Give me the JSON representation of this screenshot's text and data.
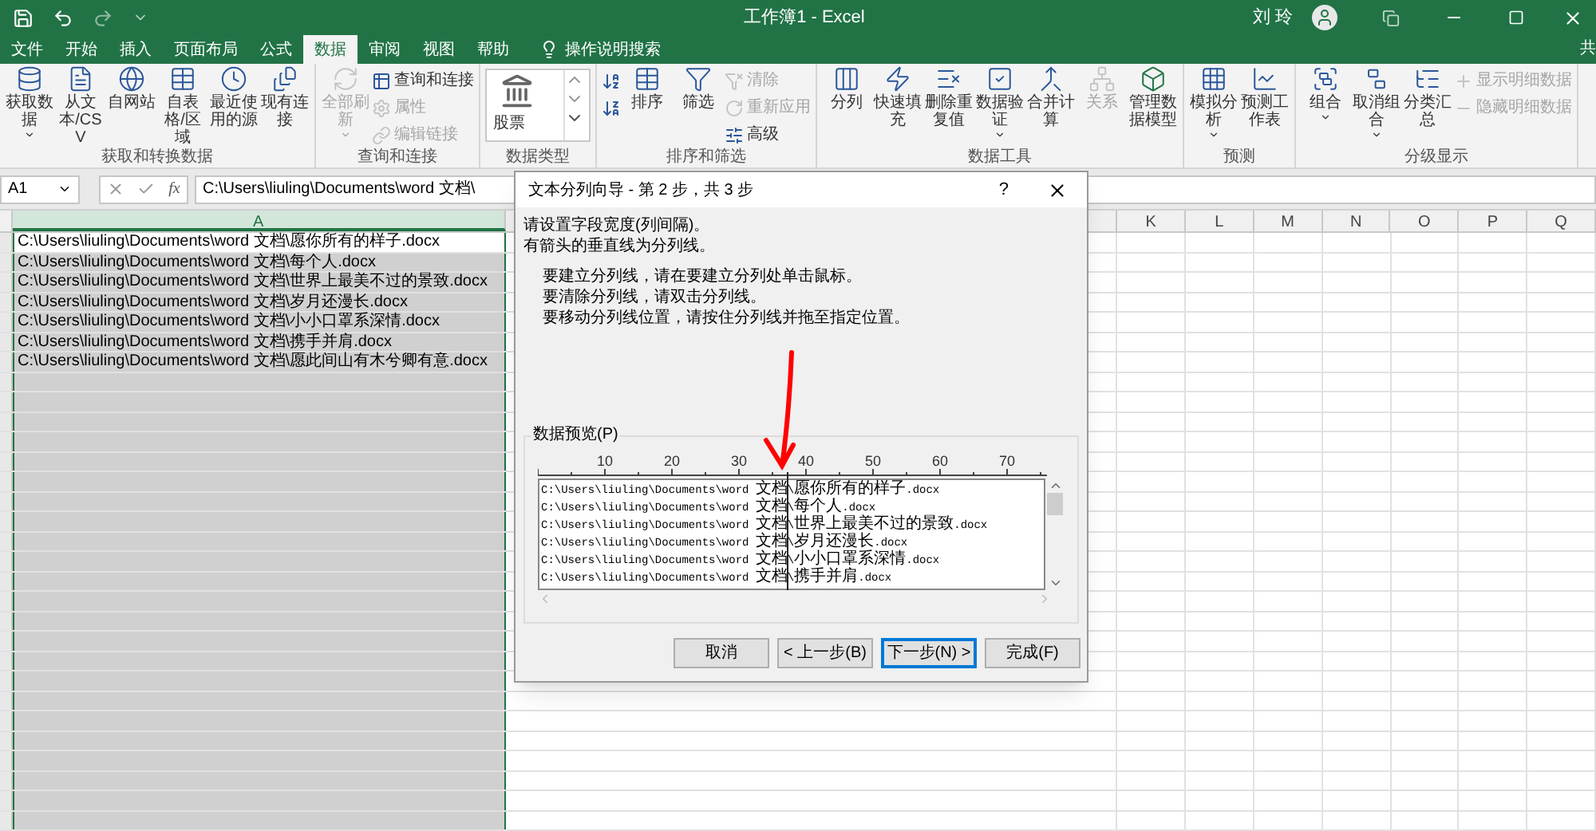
{
  "title_bar": {
    "title": "工作簿1 - Excel",
    "user": "刘 玲",
    "share": "共"
  },
  "tabs": [
    {
      "label": "文件",
      "selected": false
    },
    {
      "label": "开始",
      "selected": false
    },
    {
      "label": "插入",
      "selected": false
    },
    {
      "label": "页面布局",
      "selected": false
    },
    {
      "label": "公式",
      "selected": false
    },
    {
      "label": "数据",
      "selected": true
    },
    {
      "label": "审阅",
      "selected": false
    },
    {
      "label": "视图",
      "selected": false
    },
    {
      "label": "帮助",
      "selected": false
    }
  ],
  "search": {
    "placeholder": "操作说明搜索"
  },
  "ribbon": [
    {
      "label": "获取和转换数据",
      "items": [
        {
          "kind": "large",
          "label": "获取数据",
          "dropdown": true,
          "disabled": false
        },
        {
          "kind": "large",
          "label": "从文本/CSV",
          "disabled": false
        },
        {
          "kind": "large",
          "label": "自网站",
          "disabled": false
        },
        {
          "kind": "large",
          "label": "自表格/区域",
          "disabled": false
        },
        {
          "kind": "large",
          "label": "最近使用的源",
          "disabled": false
        },
        {
          "kind": "large",
          "label": "现有连接",
          "disabled": false
        }
      ]
    },
    {
      "label": "查询和连接",
      "items": [
        {
          "kind": "large",
          "label": "全部刷新",
          "dropdown": true,
          "disabled": true
        },
        {
          "kind": "small",
          "label": "查询和连接",
          "disabled": false
        },
        {
          "kind": "small",
          "label": "属性",
          "disabled": true
        },
        {
          "kind": "small",
          "label": "编辑链接",
          "disabled": true
        }
      ]
    },
    {
      "label": "数据类型",
      "items": [
        {
          "kind": "gallery",
          "label": "股票"
        }
      ]
    },
    {
      "label": "排序和筛选",
      "items": [
        {
          "kind": "small",
          "disabled": false
        },
        {
          "kind": "small",
          "disabled": false
        },
        {
          "kind": "large",
          "label": "排序",
          "disabled": false
        },
        {
          "kind": "large",
          "label": "筛选",
          "disabled": false
        },
        {
          "kind": "small",
          "label": "清除",
          "disabled": true
        },
        {
          "kind": "small",
          "label": "重新应用",
          "disabled": true
        },
        {
          "kind": "small",
          "label": "高级",
          "disabled": false
        }
      ]
    },
    {
      "label": "数据工具",
      "items": [
        {
          "kind": "large",
          "label": "分列",
          "disabled": false
        },
        {
          "kind": "large",
          "label": "快速填充",
          "disabled": false
        },
        {
          "kind": "large",
          "label": "删除重复值",
          "disabled": false
        },
        {
          "kind": "large",
          "label": "数据验证",
          "dropdown": true,
          "disabled": false
        },
        {
          "kind": "large",
          "label": "合并计算",
          "disabled": false
        },
        {
          "kind": "large",
          "label": "关系",
          "disabled": true
        },
        {
          "kind": "large",
          "label": "管理数据模型",
          "disabled": false
        }
      ]
    },
    {
      "label": "预测",
      "items": [
        {
          "kind": "large",
          "label": "模拟分析",
          "dropdown": true,
          "disabled": false
        },
        {
          "kind": "large",
          "label": "预测工作表",
          "disabled": false
        }
      ]
    },
    {
      "label": "分级显示",
      "items": [
        {
          "kind": "large",
          "label": "组合",
          "dropdown": true,
          "disabled": false
        },
        {
          "kind": "large",
          "label": "取消组合",
          "dropdown": true,
          "disabled": false
        },
        {
          "kind": "large",
          "label": "分类汇总",
          "disabled": false
        },
        {
          "kind": "small",
          "label": "显示明细数据",
          "disabled": true
        },
        {
          "kind": "small",
          "label": "隐藏明细数据",
          "disabled": true
        }
      ]
    }
  ],
  "formula_bar": {
    "name_box": "A1",
    "fx": "fx",
    "formula": "C:\\Users\\liuling\\Documents\\word 文档\\"
  },
  "columns": [
    {
      "label": "A",
      "selected": true
    },
    {
      "label": "K",
      "selected": false
    },
    {
      "label": "L",
      "selected": false
    },
    {
      "label": "M",
      "selected": false
    },
    {
      "label": "N",
      "selected": false
    },
    {
      "label": "O",
      "selected": false
    },
    {
      "label": "P",
      "selected": false
    },
    {
      "label": "Q",
      "selected": false
    }
  ],
  "cells": [
    {
      "text": "C:\\Users\\liuling\\Documents\\word 文档\\愿你所有的样子.docx",
      "active": true
    },
    {
      "text": "C:\\Users\\liuling\\Documents\\word 文档\\每个人.docx",
      "active": false
    },
    {
      "text": "C:\\Users\\liuling\\Documents\\word 文档\\世界上最美不过的景致.docx",
      "active": false
    },
    {
      "text": "C:\\Users\\liuling\\Documents\\word 文档\\岁月还漫长.docx",
      "active": false
    },
    {
      "text": "C:\\Users\\liuling\\Documents\\word 文档\\小小口罩系深情.docx",
      "active": false
    },
    {
      "text": "C:\\Users\\liuling\\Documents\\word 文档\\携手并肩.docx",
      "active": false
    },
    {
      "text": "C:\\Users\\liuling\\Documents\\word 文档\\愿此间山有木兮卿有意.docx",
      "active": false
    }
  ],
  "dialog": {
    "title": "文本分列向导 - 第 2 步，共 3 步",
    "help": "?",
    "intro": [
      "请设置字段宽度(列间隔)。",
      "有箭头的垂直线为分列线。"
    ],
    "instructions": [
      "要建立分列线，请在要建立分列处单击鼠标。",
      "要清除分列线，请双击分列线。",
      "要移动分列线位置，请按住分列线并拖至指定位置。"
    ],
    "preview_label": "数据预览(P)",
    "ruler": [
      "10",
      "20",
      "30",
      "40",
      "50",
      "60",
      "70"
    ],
    "divider": {
      "level": 0.49
    },
    "preview": [
      "C:\\Users\\liuling\\Documents\\word 文档\\愿你所有的样子.docx",
      "C:\\Users\\liuling\\Documents\\word 文档\\每个人.docx",
      "C:\\Users\\liuling\\Documents\\word 文档\\世界上最美不过的景致.docx",
      "C:\\Users\\liuling\\Documents\\word 文档\\岁月还漫长.docx",
      "C:\\Users\\liuling\\Documents\\word 文档\\小小口罩系深情.docx",
      "C:\\Users\\liuling\\Documents\\word 文档\\携手并肩.docx"
    ],
    "buttons": [
      {
        "label": "取消",
        "default": false
      },
      {
        "label": "< 上一步(B)",
        "default": false
      },
      {
        "label": "下一步(N) >",
        "default": true
      },
      {
        "label": "完成(F)",
        "default": false
      }
    ]
  }
}
